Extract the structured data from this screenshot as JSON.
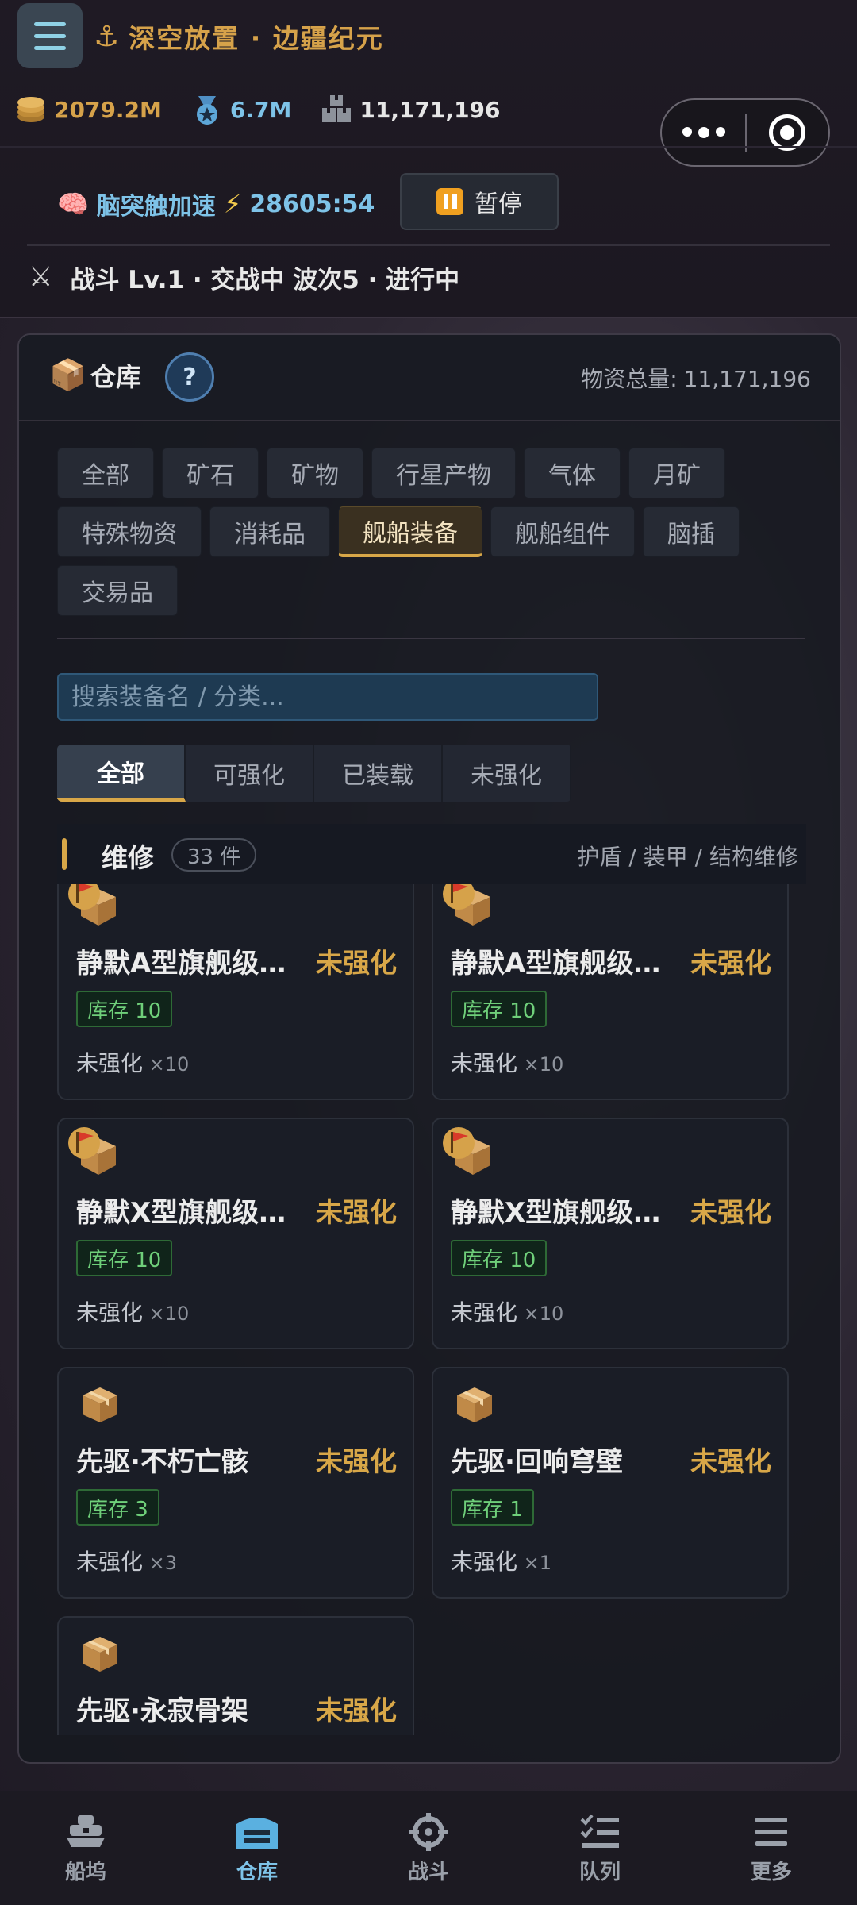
{
  "app": {
    "title": "深空放置 · 边疆纪元"
  },
  "resources": [
    {
      "value": "2079.2M",
      "icon": "coins-icon",
      "color": "#d6a24a"
    },
    {
      "value": "6.7M",
      "icon": "medal-icon",
      "color": "#7ec3e8"
    },
    {
      "value": "11,171,196",
      "icon": "crates-icon",
      "color": "#e6e6e6"
    }
  ],
  "accel": {
    "label": "脑突触加速",
    "timer": "28605:54",
    "pause_label": "暂停"
  },
  "battle": {
    "status": "战斗 Lv.1 · 交战中 波次5 · 进行中"
  },
  "warehouse": {
    "title": "仓库",
    "help_label": "?",
    "total_label": "物资总量:",
    "total_value": "11,171,196",
    "categories_row1": [
      "全部",
      "矿石",
      "矿物",
      "行星产物",
      "气体",
      "月矿"
    ],
    "categories_row2": [
      "特殊物资",
      "消耗品",
      "舰船装备",
      "舰船组件",
      "脑插"
    ],
    "categories_row3": [
      "交易品"
    ],
    "active_category": "舰船装备",
    "search_placeholder": "搜索装备名 / 分类...",
    "filters": [
      "全部",
      "可强化",
      "已装载",
      "未强化"
    ],
    "active_filter": "全部",
    "section": {
      "title": "维修",
      "count": "33 件",
      "tags": "护盾 / 装甲 / 结构维修"
    },
    "items": [
      {
        "name": "静默A型旗舰级结...",
        "state": "未强化",
        "stock": "库存 10",
        "detail": "未强化",
        "mult": "×10",
        "flag": true
      },
      {
        "name": "静默A型旗舰级结...",
        "state": "未强化",
        "stock": "库存 10",
        "detail": "未强化",
        "mult": "×10",
        "flag": true
      },
      {
        "name": "静默X型旗舰级结...",
        "state": "未强化",
        "stock": "库存 10",
        "detail": "未强化",
        "mult": "×10",
        "flag": true
      },
      {
        "name": "静默X型旗舰级结...",
        "state": "未强化",
        "stock": "库存 10",
        "detail": "未强化",
        "mult": "×10",
        "flag": true
      },
      {
        "name": "先驱·不朽亡骸",
        "state": "未强化",
        "stock": "库存 3",
        "detail": "未强化",
        "mult": "×3",
        "flag": false
      },
      {
        "name": "先驱·回响穹壁",
        "state": "未强化",
        "stock": "库存 1",
        "detail": "未强化",
        "mult": "×1",
        "flag": false
      },
      {
        "name": "先驱·永寂骨架",
        "state": "未强化",
        "stock": "",
        "detail": "",
        "mult": "",
        "flag": false
      }
    ]
  },
  "nav": [
    {
      "label": "船坞",
      "icon": "ship-icon",
      "active": false
    },
    {
      "label": "仓库",
      "icon": "warehouse-icon",
      "active": true
    },
    {
      "label": "战斗",
      "icon": "crosshair-icon",
      "active": false
    },
    {
      "label": "队列",
      "icon": "checklist-icon",
      "active": false
    },
    {
      "label": "更多",
      "icon": "menu-icon",
      "active": false
    }
  ],
  "colors": {
    "accent_gold": "#d8a748",
    "accent_blue": "#7ec3e8",
    "stock_green": "#6fcf7a"
  }
}
